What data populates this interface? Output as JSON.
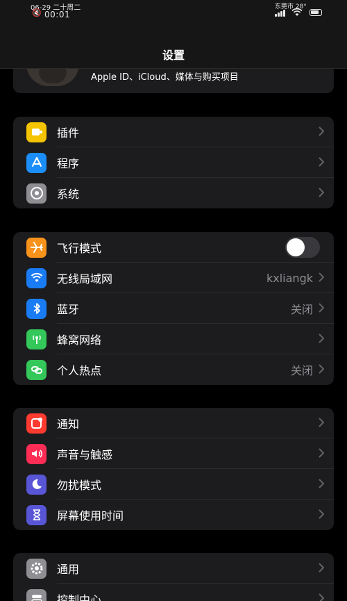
{
  "status": {
    "date": "06-29 二十周二",
    "time": "00:01",
    "weather": "东莞市 28°"
  },
  "header": {
    "title": "设置"
  },
  "profile": {
    "subtitle": "Apple ID、iCloud、媒体与购买项目"
  },
  "groups": [
    {
      "items": [
        {
          "label": "插件",
          "icon": "plugin-icon",
          "color": "#f5c400"
        },
        {
          "label": "程序",
          "icon": "app-store-icon",
          "color": "#1c8ef9"
        },
        {
          "label": "系统",
          "icon": "gear-system-icon",
          "color": "#8e8e93"
        }
      ]
    },
    {
      "items": [
        {
          "label": "飞行模式",
          "icon": "airplane-icon",
          "color": "#f7931a",
          "toggle": false
        },
        {
          "label": "无线局域网",
          "icon": "wifi-icon",
          "color": "#1a7cf5",
          "value": "kxliangk"
        },
        {
          "label": "蓝牙",
          "icon": "bluetooth-icon",
          "color": "#1a7cf5",
          "value": "关闭"
        },
        {
          "label": "蜂窝网络",
          "icon": "cellular-icon",
          "color": "#34c759"
        },
        {
          "label": "个人热点",
          "icon": "hotspot-icon",
          "color": "#34c759",
          "value": "关闭"
        }
      ]
    },
    {
      "items": [
        {
          "label": "通知",
          "icon": "notification-icon",
          "color": "#ff3b30"
        },
        {
          "label": "声音与触感",
          "icon": "sound-icon",
          "color": "#ff2d55"
        },
        {
          "label": "勿扰模式",
          "icon": "moon-icon",
          "color": "#5856d6"
        },
        {
          "label": "屏幕使用时间",
          "icon": "hourglass-icon",
          "color": "#5856d6"
        }
      ]
    },
    {
      "items": [
        {
          "label": "通用",
          "icon": "gear-icon",
          "color": "#8e8e93"
        },
        {
          "label": "控制中心",
          "icon": "control-center-icon",
          "color": "#8e8e93"
        }
      ]
    }
  ]
}
